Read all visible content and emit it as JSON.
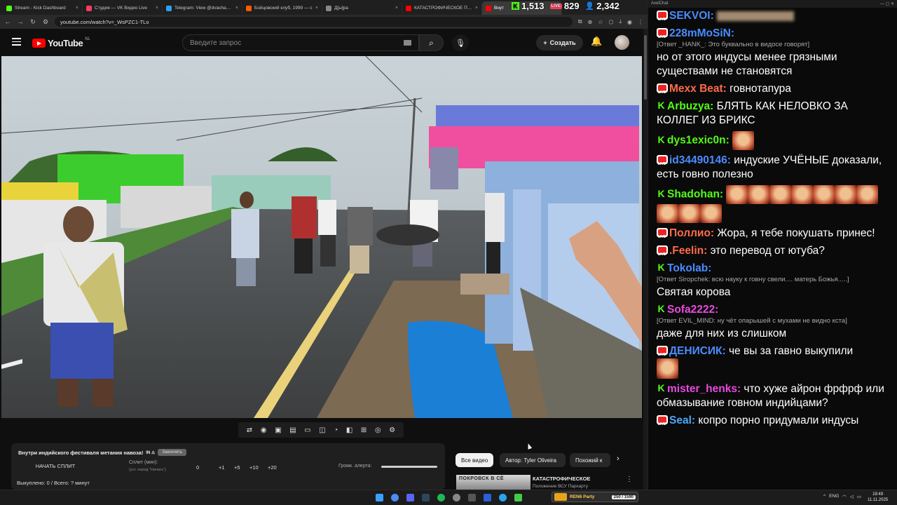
{
  "browser": {
    "tabs": [
      {
        "label": "Stream - Kick Dashboard",
        "color": "#53fc18"
      },
      {
        "label": "Студия — VK Видео Live",
        "color": "#ff3a5e"
      },
      {
        "label": "Telegram: View @dvachannel",
        "color": "#2aa3ef"
      },
      {
        "label": "Бойцовский клуб, 1999 — с",
        "color": "#ff5a00"
      },
      {
        "label": "Д[ы]ра",
        "color": "#888888"
      },
      {
        "label": "КАТАСТРОФИЧЕСКОЕ Пор",
        "color": "#ff0000"
      },
      {
        "label": "Внут",
        "color": "#ff0000"
      }
    ],
    "url": "youtube.com/watch?v=_WsPZC1-TLo"
  },
  "overlay": {
    "kick_viewers": "1,513",
    "vk_viewers": "829",
    "total_viewers": "2,342"
  },
  "youtube": {
    "logo": "YouTube",
    "region": "NL",
    "search_placeholder": "Введите запрос",
    "create_label": "Создать",
    "subtitle": "yes",
    "chips": [
      "Все видео",
      "Автор: Tyler Oliveira",
      "Похожий к"
    ],
    "next_video": {
      "thumb_text": "ПОКРОВСК В СЁ",
      "title": "КАТАСТРОФИЧЕСКОЕ",
      "subtitle": "Положение ВСУ Пархарту"
    }
  },
  "split_panel": {
    "title": "Внутри индийского фестиваля метания навоза!",
    "title_tag": "Закончить",
    "start_button": "НАЧАТЬ СПЛИТ",
    "split_label": "Сплит (мин):",
    "split_hint": "(уст. перед \"Начать\")",
    "split_value": "0",
    "increments": [
      "+1",
      "+5",
      "+10",
      "+20"
    ],
    "alert_volume_label": "Громк. алерта:",
    "bought": "Выкуплено: 0 / Всего: ? минут"
  },
  "chat": {
    "app_title": "AxelChat",
    "messages": [
      {
        "platform": "youtube",
        "nick": "SEKVOI:",
        "nick_color": "#4a8cff",
        "text": "",
        "reply": "",
        "emotes": 0
      },
      {
        "platform": "youtube",
        "nick": "228mMoSiN:",
        "nick_color": "#4a8cff",
        "reply": "[Ответ _HANK_: Это буквально в видосе говорят]",
        "text": "но от этого индусы менее грязными существами не становятся",
        "emotes": 0
      },
      {
        "platform": "youtube",
        "nick": "Mexx Beat:",
        "nick_color": "#ff6b4a",
        "reply": "",
        "text": "говнотапура",
        "emotes": 0
      },
      {
        "platform": "kick",
        "nick": "Arbuzya:",
        "nick_color": "#53fc18",
        "reply": "",
        "text": "БЛЯТЬ КАК НЕЛОВКО ЗА КОЛЛЕГ ИЗ БРИКС",
        "emotes": 0
      },
      {
        "platform": "kick",
        "nick": "dys1exic0n:",
        "nick_color": "#53fc18",
        "reply": "",
        "text": "",
        "emotes": 1
      },
      {
        "platform": "youtube",
        "nick": "id34490146:",
        "nick_color": "#4a8cff",
        "reply": "",
        "text": "индуские УЧЁНЫЕ доказали, есть говно полезно",
        "emotes": 0
      },
      {
        "platform": "kick",
        "nick": "Shadohan:",
        "nick_color": "#53fc18",
        "reply": "",
        "text": "",
        "emotes": 10
      },
      {
        "platform": "youtube",
        "nick": "Поллио:",
        "nick_color": "#ff6b4a",
        "reply": "",
        "text": "Жора, я тебе покушать принес!",
        "emotes": 0
      },
      {
        "platform": "youtube",
        "nick": ".Feelin:",
        "nick_color": "#ff6b4a",
        "reply": "",
        "text": "это перевод от ютуба?",
        "emotes": 0
      },
      {
        "platform": "kick",
        "nick": "Tokolab:",
        "nick_color": "#4a8cff",
        "reply": "[Ответ Siropchek: всю науку к говну свели.... матерь Божья.....]",
        "text": "Святая корова",
        "emotes": 0
      },
      {
        "platform": "kick",
        "nick": "Sofa2222:",
        "nick_color": "#e84adf",
        "reply": "[Ответ EVIL_MIND: ну чёт опарышей с мухами не видно кста]",
        "text": "даже для них из слишком",
        "emotes": 0
      },
      {
        "platform": "youtube",
        "nick": "ДЕНИСИК:",
        "nick_color": "#4a8cff",
        "reply": "",
        "text": "че вы за гавно выкупили",
        "emotes": 1
      },
      {
        "platform": "kick",
        "nick": "mister_henks:",
        "nick_color": "#e84adf",
        "reply": "",
        "text": "что хуже айрон фрфрф или обмазывание говном индийцами?",
        "emotes": 0
      },
      {
        "platform": "youtube",
        "nick": "Seal:",
        "nick_color": "#4aa8ff",
        "reply": "",
        "text": "копро порно придумали индусы",
        "emotes": 0
      }
    ]
  },
  "taskbar": {
    "donation_pill_text": "REN6 Party",
    "donation_pill_count": "250 / 1590",
    "lang": "ENG",
    "time": "19:49",
    "date": "11.11.2025"
  }
}
